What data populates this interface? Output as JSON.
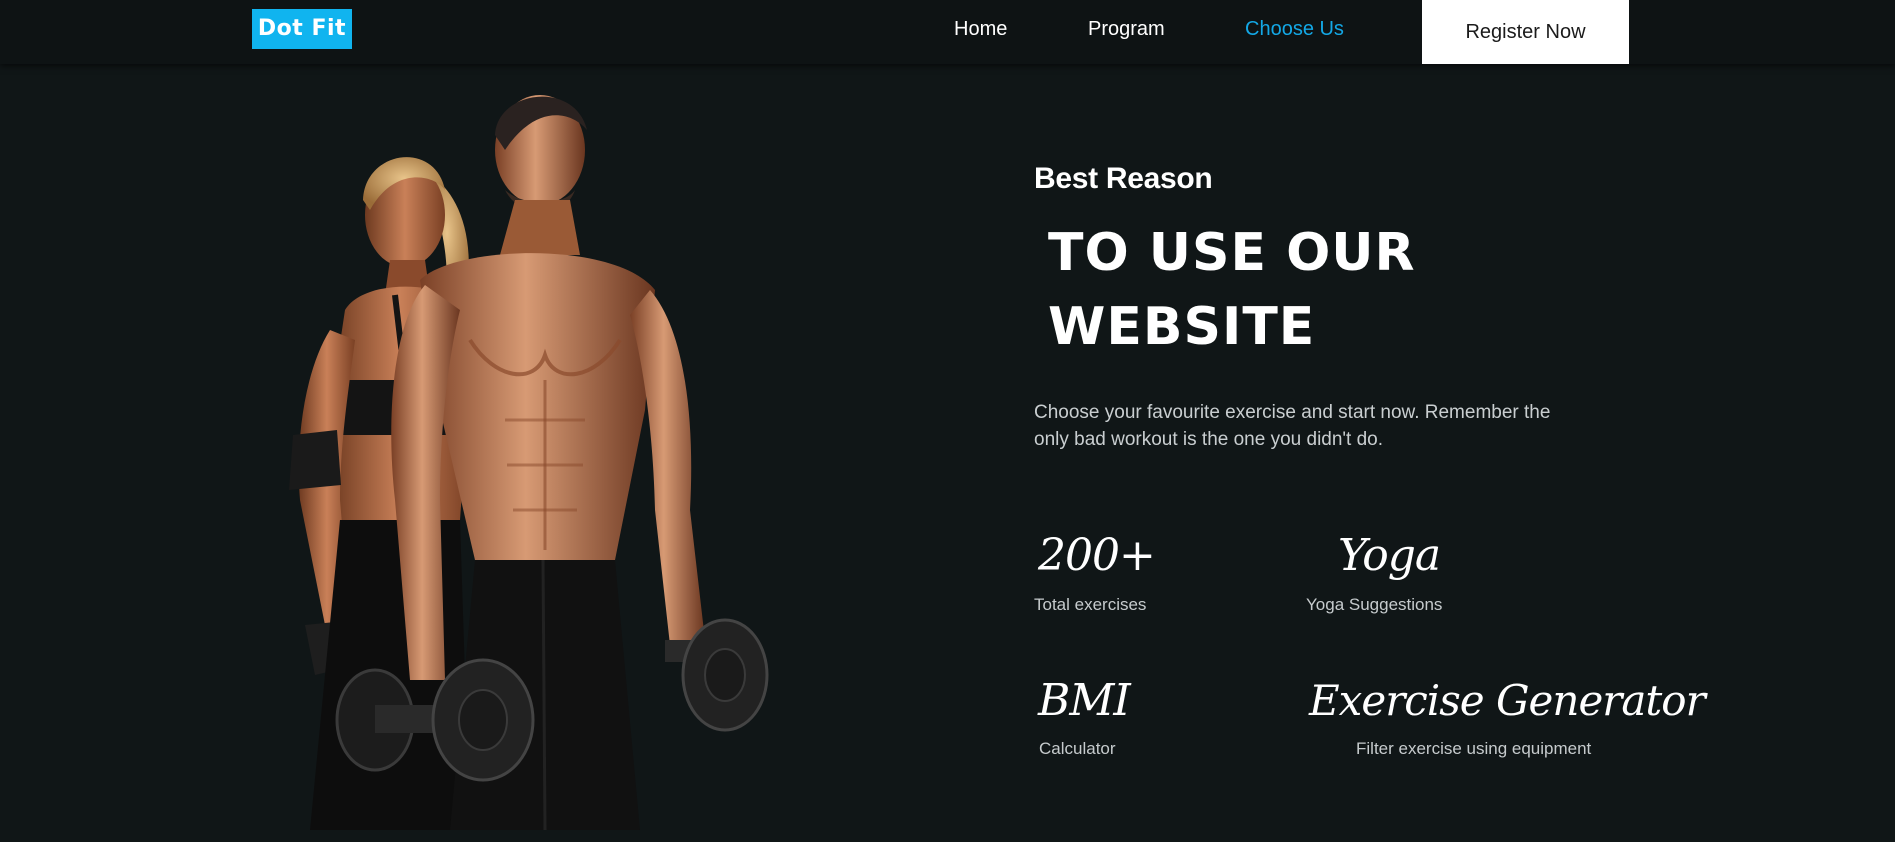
{
  "nav": {
    "logo": "Dot Fit",
    "links": [
      {
        "label": "Home"
      },
      {
        "label": "Program"
      },
      {
        "label": "Choose Us",
        "active": true
      }
    ],
    "register_label": "Register Now"
  },
  "colors": {
    "background": "#101617",
    "accent": "#13a8e6",
    "logo_bg": "#10b4ef",
    "button_bg": "#ffffff"
  },
  "hero_image": {
    "icon": "athletes-with-dumbbells-photo"
  },
  "content": {
    "kicker": "Best Reason",
    "headline_line1": "TO USE OUR",
    "headline_line2": "WEBSITE",
    "description": "Choose your favourite exercise and start now. Remember the only bad workout is the one you didn't do.",
    "stats": [
      {
        "value": "200+",
        "caption": "Total exercises"
      },
      {
        "value": "Yoga",
        "caption": "Yoga Suggestions"
      },
      {
        "value": "BMI",
        "caption": "Calculator"
      },
      {
        "value": "Exercise Generator",
        "caption": "Filter exercise using equipment"
      }
    ]
  }
}
